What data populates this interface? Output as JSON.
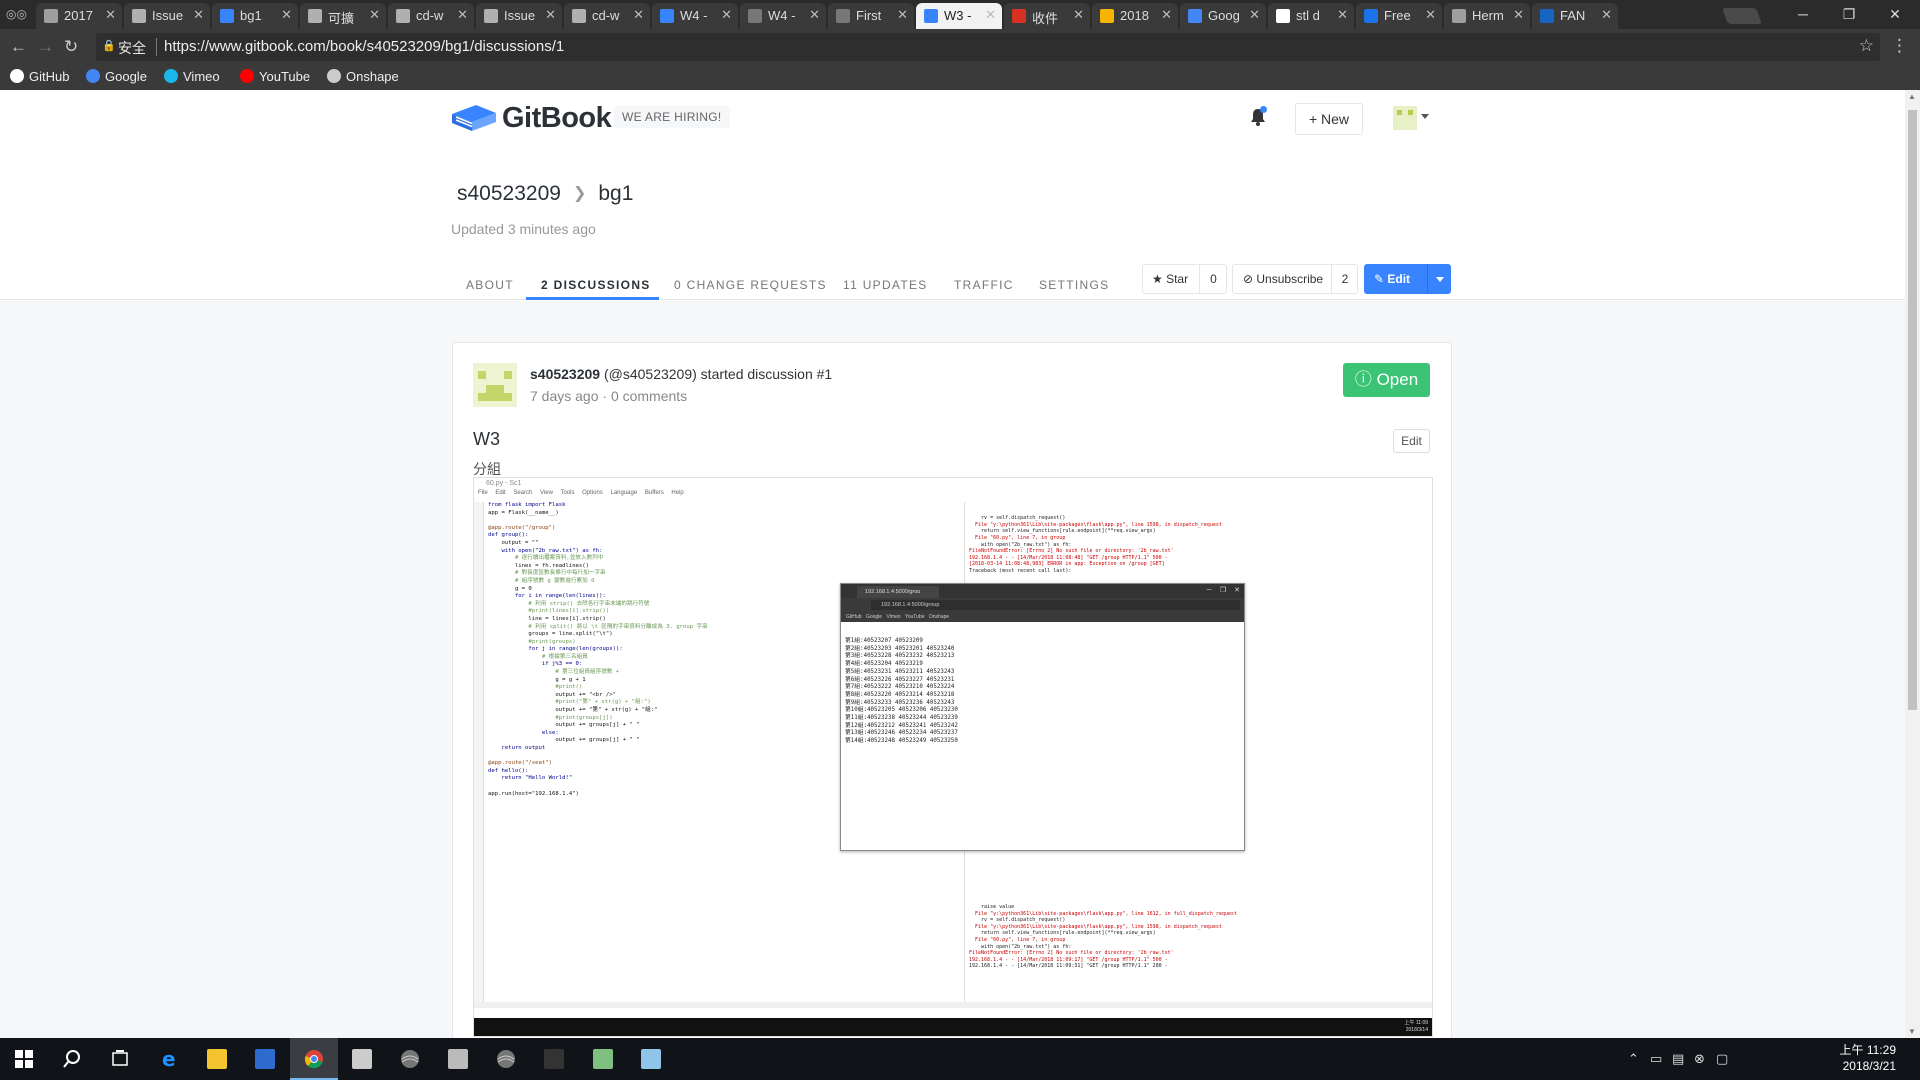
{
  "browser": {
    "tabs": [
      {
        "title": "2017",
        "color": "#9e9e9e"
      },
      {
        "title": "Issue",
        "color": "#b0b0b0"
      },
      {
        "title": "bg1",
        "color": "#3884ff"
      },
      {
        "title": "可擴",
        "color": "#b0b0b0"
      },
      {
        "title": "cd-w",
        "color": "#b0b0b0"
      },
      {
        "title": "Issue",
        "color": "#b0b0b0"
      },
      {
        "title": "cd-w",
        "color": "#b0b0b0"
      },
      {
        "title": "W4 -",
        "color": "#3884ff"
      },
      {
        "title": "W4 -",
        "color": "#777777"
      },
      {
        "title": "First",
        "color": "#777777"
      },
      {
        "title": "W3 -",
        "color": "#3884ff"
      },
      {
        "title": "收件",
        "color": "#d93025"
      },
      {
        "title": "2018",
        "color": "#f4b400"
      },
      {
        "title": "Goog",
        "color": "#4285f4"
      },
      {
        "title": "stl d",
        "color": "#ffffff"
      },
      {
        "title": "Free",
        "color": "#1a73e8"
      },
      {
        "title": "Herm",
        "color": "#9e9e9e"
      },
      {
        "title": "FAN",
        "color": "#1565c0"
      }
    ],
    "active_tab_index": 10,
    "window_buttons": {
      "minimize": "─",
      "restore": "❐",
      "close": "✕"
    },
    "secure_label": "安全",
    "url": "https://www.gitbook.com/book/s40523209/bg1/discussions/1",
    "bookmarks": [
      {
        "label": "GitHub",
        "icon": "github-icon",
        "color": "#ffffff"
      },
      {
        "label": "Google",
        "icon": "google-icon",
        "color": "#4285f4"
      },
      {
        "label": "Vimeo",
        "icon": "vimeo-icon",
        "color": "#1ab7ea"
      },
      {
        "label": "YouTube",
        "icon": "youtube-icon",
        "color": "#ff0000"
      },
      {
        "label": "Onshape",
        "icon": "page-icon",
        "color": "#cccccc"
      }
    ]
  },
  "header": {
    "brand": "GitBook",
    "hiring": "WE ARE HIRING!",
    "new_label": "+ New",
    "accent": "#3884ff"
  },
  "book": {
    "owner": "s40523209",
    "name": "bg1",
    "updated": "Updated 3 minutes ago"
  },
  "tabs": [
    {
      "label": "ABOUT"
    },
    {
      "label": "2 DISCUSSIONS"
    },
    {
      "label": "0 CHANGE REQUESTS"
    },
    {
      "label": "11 UPDATES"
    },
    {
      "label": "TRAFFIC"
    },
    {
      "label": "SETTINGS"
    }
  ],
  "active_tab": "2 DISCUSSIONS",
  "actions": {
    "star_label": "★ Star",
    "star_count": "0",
    "unsubscribe_label": "⊘ Unsubscribe",
    "unsubscribe_count": "2",
    "edit_label": "✎ Edit"
  },
  "discussion": {
    "author_handle": "s40523209",
    "author_rest": " (@s40523209) started discussion #1",
    "meta": "7 days ago · 0 comments",
    "status": "ⓘ Open",
    "status_color": "#3bc476",
    "title": "W3",
    "edit_label": "Edit",
    "body_label": "分組"
  },
  "screenshot": {
    "editor_title": "60.py - Sc1",
    "editor_menu": "File Edit Search View Tools Options Language Buffers Help",
    "code": [
      "from flask import Flask",
      "app = Flask(__name__)",
      "",
      "@app.route(\"/group\")",
      "def group():",
      "    output = \"\"",
      "    with open(\"2b_raw.txt\") as fh:",
      "        # 逐行讀出檔案資料,並放入數列中",
      "        lines = fh.readlines()",
      "        # 對長度區數長條行中每行加一字串",
      "        # 組序號數 g 變數進行累加 0",
      "        g = 0",
      "        for i in range(len(lines)):",
      "            # 利用 strip() 去除各行字串末端的跳行符號",
      "            #print(lines[i].strip())",
      "            line = lines[i].strip()",
      "            # 利用 split() 將以 \\t 區隔的字串資料分離成為 3. group 字串",
      "            groups = line.split(\"\\t\")",
      "            #print(groups)",
      "            for j in range(len(groups)):",
      "                # 根據第三名組員",
      "                if j%3 == 0:",
      "                    # 第三位組員組序號數 +",
      "                    g = g + 1",
      "                    #print()",
      "                    output += \"<br />\"",
      "                    #print(\"第\" + str(g) + \"組:\")",
      "                    output += \"第\" + str(g) + \"組:\"",
      "                    #print(groups[j])",
      "                    output += groups[j] + \" \"",
      "                else:",
      "                    output += groups[j] + \" \"",
      "    return output",
      "",
      "@app.route(\"/seat\")",
      "def hello():",
      "    return \"Hello World!\"",
      "",
      "app.run(host=\"192.168.1.4\")"
    ],
    "console_top": [
      "    rv = self.dispatch_request()",
      "  File \"y:\\python361\\Lib\\site-packages\\flask\\app.py\", line 1598, in dispatch_request",
      "    return self.view_functions[rule.endpoint](**req.view_args)",
      "  File \"60.py\", line 7, in group",
      "    with open(\"2b_raw.txt\") as fh:",
      "FileNotFoundError: [Errno 2] No such file or directory: '2b_raw.txt'",
      "192.168.1.4 - - [14/Mar/2018 11:08:48] \"GET /group HTTP/1.1\" 500 -",
      "[2018-03-14 11:08:48,983] ERROR in app: Exception on /group [GET]",
      "Traceback (most recent call last):"
    ],
    "console_bottom": [
      "    raise value",
      "  File \"y:\\python361\\Lib\\site-packages\\flask\\app.py\", line 1612, in full_dispatch_request",
      "    rv = self.dispatch_request()",
      "  File \"y:\\python361\\Lib\\site-packages\\flask\\app.py\", line 1598, in dispatch_request",
      "    return self.view_functions[rule.endpoint](**req.view_args)",
      "  File \"60.py\", line 7, in group",
      "    with open(\"2b_raw.txt\") as fh:",
      "FileNotFoundError: [Errno 2] No such file or directory: '2b_raw.txt'",
      "192.168.1.4 - - [14/Mar/2018 11:09:17] \"GET /group HTTP/1.1\" 500 -",
      "192.168.1.4 - - [14/Mar/2018 11:09:31] \"GET /group HTTP/1.1\" 200 -"
    ],
    "inner_tab": "192.168.1.4:5000/grou",
    "inner_url": "192.168.1.4:5000/group",
    "inner_bookmarks": "GitHub Google Vimeo YouTube Onshape",
    "groups": [
      "第1組:40523207 40523209",
      "第2組:40523203 40523201 40523240",
      "第3組:40523228 40523232 40523213",
      "第4組:40523204 40523219",
      "第5組:40523231 40523211 40523243",
      "第6組:40523226 40523227 40523231",
      "第7組:40523222 40523210 40523224",
      "第8組:40523220 40523214 40523218",
      "第9組:40523233 40523236 40523243",
      "第10組:40523205 40523206 40523230",
      "第11組:40523238 40523244 40523239",
      "第12組:40523212 40523241 40523242",
      "第13組:40523246 40523234 40523237",
      "第14組:40523248 40523249 40523250"
    ],
    "mini_clock": "上午 11:09\n2018/3/14"
  },
  "taskbar": {
    "apps": [
      {
        "name": "windows-start-icon",
        "color": "#ffffff"
      },
      {
        "name": "search-icon",
        "color": "#ffffff"
      },
      {
        "name": "task-view-icon",
        "color": "#ffffff"
      },
      {
        "name": "edge-icon",
        "color": "#1e90ff"
      },
      {
        "name": "file-explorer-icon",
        "color": "#f4c430"
      },
      {
        "name": "powershell-icon",
        "color": "#2d6bcf"
      },
      {
        "name": "chrome-icon",
        "color": "#fbbc05"
      },
      {
        "name": "terminal-icon",
        "color": "#cccccc"
      },
      {
        "name": "app-sphere-icon",
        "color": "#999999"
      },
      {
        "name": "app-window-icon",
        "color": "#bbbbbb"
      },
      {
        "name": "app-sphere2-icon",
        "color": "#999999"
      },
      {
        "name": "app-dark-icon",
        "color": "#333333"
      },
      {
        "name": "app-green-icon",
        "color": "#7fbf7f"
      },
      {
        "name": "app-notepad-icon",
        "color": "#8ec5e8"
      }
    ],
    "time": "上午 11:29",
    "date": "2018/3/21"
  }
}
